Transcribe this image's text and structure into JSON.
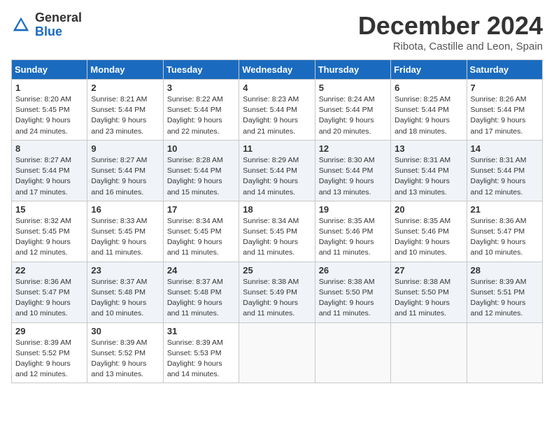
{
  "logo": {
    "general": "General",
    "blue": "Blue"
  },
  "title": "December 2024",
  "subtitle": "Ribota, Castille and Leon, Spain",
  "headers": [
    "Sunday",
    "Monday",
    "Tuesday",
    "Wednesday",
    "Thursday",
    "Friday",
    "Saturday"
  ],
  "weeks": [
    [
      {
        "day": "1",
        "sunrise": "Sunrise: 8:20 AM",
        "sunset": "Sunset: 5:45 PM",
        "daylight": "Daylight: 9 hours and 24 minutes."
      },
      {
        "day": "2",
        "sunrise": "Sunrise: 8:21 AM",
        "sunset": "Sunset: 5:44 PM",
        "daylight": "Daylight: 9 hours and 23 minutes."
      },
      {
        "day": "3",
        "sunrise": "Sunrise: 8:22 AM",
        "sunset": "Sunset: 5:44 PM",
        "daylight": "Daylight: 9 hours and 22 minutes."
      },
      {
        "day": "4",
        "sunrise": "Sunrise: 8:23 AM",
        "sunset": "Sunset: 5:44 PM",
        "daylight": "Daylight: 9 hours and 21 minutes."
      },
      {
        "day": "5",
        "sunrise": "Sunrise: 8:24 AM",
        "sunset": "Sunset: 5:44 PM",
        "daylight": "Daylight: 9 hours and 20 minutes."
      },
      {
        "day": "6",
        "sunrise": "Sunrise: 8:25 AM",
        "sunset": "Sunset: 5:44 PM",
        "daylight": "Daylight: 9 hours and 18 minutes."
      },
      {
        "day": "7",
        "sunrise": "Sunrise: 8:26 AM",
        "sunset": "Sunset: 5:44 PM",
        "daylight": "Daylight: 9 hours and 17 minutes."
      }
    ],
    [
      {
        "day": "8",
        "sunrise": "Sunrise: 8:27 AM",
        "sunset": "Sunset: 5:44 PM",
        "daylight": "Daylight: 9 hours and 17 minutes."
      },
      {
        "day": "9",
        "sunrise": "Sunrise: 8:27 AM",
        "sunset": "Sunset: 5:44 PM",
        "daylight": "Daylight: 9 hours and 16 minutes."
      },
      {
        "day": "10",
        "sunrise": "Sunrise: 8:28 AM",
        "sunset": "Sunset: 5:44 PM",
        "daylight": "Daylight: 9 hours and 15 minutes."
      },
      {
        "day": "11",
        "sunrise": "Sunrise: 8:29 AM",
        "sunset": "Sunset: 5:44 PM",
        "daylight": "Daylight: 9 hours and 14 minutes."
      },
      {
        "day": "12",
        "sunrise": "Sunrise: 8:30 AM",
        "sunset": "Sunset: 5:44 PM",
        "daylight": "Daylight: 9 hours and 13 minutes."
      },
      {
        "day": "13",
        "sunrise": "Sunrise: 8:31 AM",
        "sunset": "Sunset: 5:44 PM",
        "daylight": "Daylight: 9 hours and 13 minutes."
      },
      {
        "day": "14",
        "sunrise": "Sunrise: 8:31 AM",
        "sunset": "Sunset: 5:44 PM",
        "daylight": "Daylight: 9 hours and 12 minutes."
      }
    ],
    [
      {
        "day": "15",
        "sunrise": "Sunrise: 8:32 AM",
        "sunset": "Sunset: 5:45 PM",
        "daylight": "Daylight: 9 hours and 12 minutes."
      },
      {
        "day": "16",
        "sunrise": "Sunrise: 8:33 AM",
        "sunset": "Sunset: 5:45 PM",
        "daylight": "Daylight: 9 hours and 11 minutes."
      },
      {
        "day": "17",
        "sunrise": "Sunrise: 8:34 AM",
        "sunset": "Sunset: 5:45 PM",
        "daylight": "Daylight: 9 hours and 11 minutes."
      },
      {
        "day": "18",
        "sunrise": "Sunrise: 8:34 AM",
        "sunset": "Sunset: 5:45 PM",
        "daylight": "Daylight: 9 hours and 11 minutes."
      },
      {
        "day": "19",
        "sunrise": "Sunrise: 8:35 AM",
        "sunset": "Sunset: 5:46 PM",
        "daylight": "Daylight: 9 hours and 11 minutes."
      },
      {
        "day": "20",
        "sunrise": "Sunrise: 8:35 AM",
        "sunset": "Sunset: 5:46 PM",
        "daylight": "Daylight: 9 hours and 10 minutes."
      },
      {
        "day": "21",
        "sunrise": "Sunrise: 8:36 AM",
        "sunset": "Sunset: 5:47 PM",
        "daylight": "Daylight: 9 hours and 10 minutes."
      }
    ],
    [
      {
        "day": "22",
        "sunrise": "Sunrise: 8:36 AM",
        "sunset": "Sunset: 5:47 PM",
        "daylight": "Daylight: 9 hours and 10 minutes."
      },
      {
        "day": "23",
        "sunrise": "Sunrise: 8:37 AM",
        "sunset": "Sunset: 5:48 PM",
        "daylight": "Daylight: 9 hours and 10 minutes."
      },
      {
        "day": "24",
        "sunrise": "Sunrise: 8:37 AM",
        "sunset": "Sunset: 5:48 PM",
        "daylight": "Daylight: 9 hours and 11 minutes."
      },
      {
        "day": "25",
        "sunrise": "Sunrise: 8:38 AM",
        "sunset": "Sunset: 5:49 PM",
        "daylight": "Daylight: 9 hours and 11 minutes."
      },
      {
        "day": "26",
        "sunrise": "Sunrise: 8:38 AM",
        "sunset": "Sunset: 5:50 PM",
        "daylight": "Daylight: 9 hours and 11 minutes."
      },
      {
        "day": "27",
        "sunrise": "Sunrise: 8:38 AM",
        "sunset": "Sunset: 5:50 PM",
        "daylight": "Daylight: 9 hours and 11 minutes."
      },
      {
        "day": "28",
        "sunrise": "Sunrise: 8:39 AM",
        "sunset": "Sunset: 5:51 PM",
        "daylight": "Daylight: 9 hours and 12 minutes."
      }
    ],
    [
      {
        "day": "29",
        "sunrise": "Sunrise: 8:39 AM",
        "sunset": "Sunset: 5:52 PM",
        "daylight": "Daylight: 9 hours and 12 minutes."
      },
      {
        "day": "30",
        "sunrise": "Sunrise: 8:39 AM",
        "sunset": "Sunset: 5:52 PM",
        "daylight": "Daylight: 9 hours and 13 minutes."
      },
      {
        "day": "31",
        "sunrise": "Sunrise: 8:39 AM",
        "sunset": "Sunset: 5:53 PM",
        "daylight": "Daylight: 9 hours and 14 minutes."
      },
      null,
      null,
      null,
      null
    ]
  ]
}
